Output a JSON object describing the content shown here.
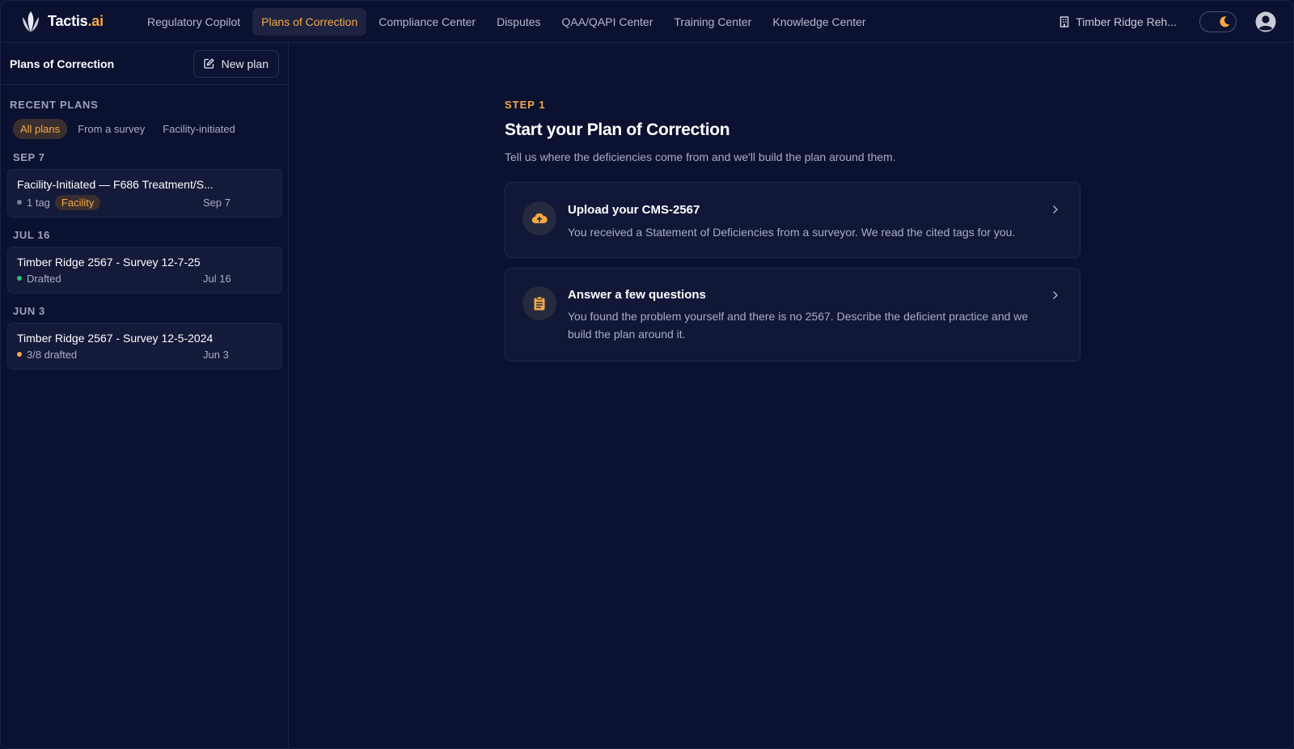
{
  "brand": {
    "name_main": "Tactis",
    "name_suffix": ".ai"
  },
  "nav": {
    "items": [
      {
        "label": "Regulatory Copilot"
      },
      {
        "label": "Plans of Correction"
      },
      {
        "label": "Compliance Center"
      },
      {
        "label": "Disputes"
      },
      {
        "label": "QAA/QAPI Center"
      },
      {
        "label": "Training Center"
      },
      {
        "label": "Knowledge Center"
      }
    ],
    "active_index": 1
  },
  "topbar": {
    "facility": "Timber Ridge Reh...",
    "theme": "dark"
  },
  "sidebar": {
    "title": "Plans of Correction",
    "new_plan_label": "New plan",
    "section_label": "RECENT PLANS",
    "filters": [
      "All plans",
      "From a survey",
      "Facility-initiated"
    ],
    "active_filter": 0,
    "groups": [
      {
        "label": "SEP 7",
        "plan": {
          "title": "Facility-Initiated — F686 Treatment/S...",
          "status": "1 tag",
          "badge": "Facility",
          "date": "Sep 7",
          "dot_color": "#7a8096"
        }
      },
      {
        "label": "JUL 16",
        "plan": {
          "title": "Timber Ridge 2567 - Survey 12-7-25",
          "status": "Drafted",
          "date": "Jul 16",
          "dot_color": "#2fbf71"
        }
      },
      {
        "label": "JUN 3",
        "plan": {
          "title": "Timber Ridge 2567 - Survey 12-5-2024",
          "status": "3/8 drafted",
          "date": "Jun 3",
          "dot_color": "#f5a845"
        }
      }
    ]
  },
  "main": {
    "step": "STEP 1",
    "heading": "Start your Plan of Correction",
    "subheading": "Tell us where the deficiencies come from and we'll build the plan around them.",
    "options": [
      {
        "icon": "cloud-upload-icon",
        "title": "Upload your CMS-2567",
        "description": "You received a Statement of Deficiencies from a surveyor. We read the cited tags for you."
      },
      {
        "icon": "clipboard-icon",
        "title": "Answer a few questions",
        "description": "You found the problem yourself and there is no 2567. Describe the deficient practice and we build the plan around it."
      }
    ]
  },
  "colors": {
    "accent": "#f5a845",
    "background": "#0b1130",
    "card": "#141a3a"
  }
}
